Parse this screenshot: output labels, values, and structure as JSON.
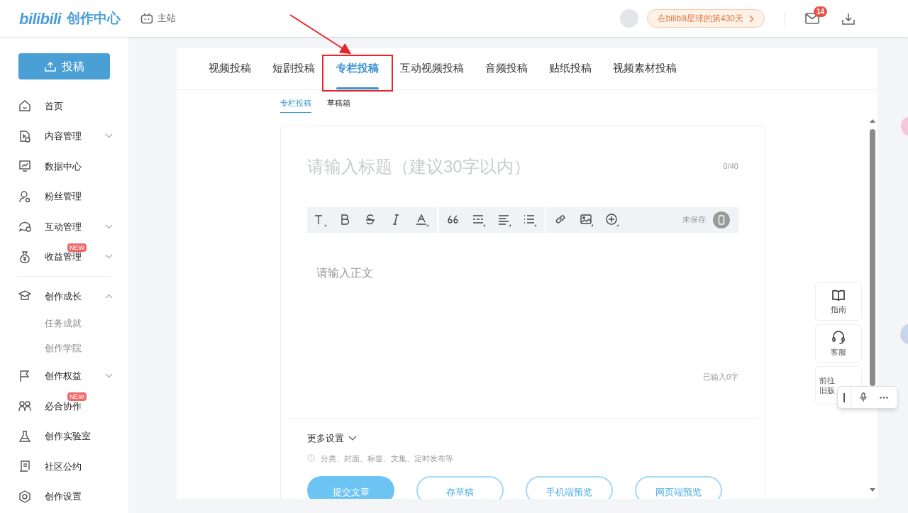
{
  "header": {
    "logo": "bilibili",
    "logo_suffix": "创作中心",
    "main_site": "主站",
    "days_pill": "在bilibili星球的第430天",
    "mail_count": "14"
  },
  "sidebar": {
    "upload_button": "投稿",
    "groups": [
      [
        {
          "label": "首页"
        },
        {
          "label": "内容管理",
          "expanded": false
        },
        {
          "label": "数据中心"
        },
        {
          "label": "粉丝管理"
        },
        {
          "label": "互动管理",
          "expanded": false
        },
        {
          "label": "收益管理",
          "expanded": false,
          "badge": "NEW"
        }
      ],
      [
        {
          "label": "创作成长",
          "expanded": true,
          "children": [
            {
              "label": "任务成就"
            },
            {
              "label": "创作学院"
            }
          ]
        },
        {
          "label": "创作权益",
          "expanded": false
        },
        {
          "label": "必合协作",
          "badge": "NEW"
        },
        {
          "label": "创作实验室"
        },
        {
          "label": "社区公约"
        },
        {
          "label": "创作设置"
        }
      ]
    ]
  },
  "tabs": [
    {
      "label": "视频投稿",
      "selected": false,
      "annotated": false
    },
    {
      "label": "短剧投稿",
      "selected": false,
      "annotated": false
    },
    {
      "label": "专栏投稿",
      "selected": true,
      "annotated": true
    },
    {
      "label": "互动视频投稿",
      "selected": false,
      "annotated": false
    },
    {
      "label": "音频投稿",
      "selected": false,
      "annotated": false
    },
    {
      "label": "贴纸投稿",
      "selected": false,
      "annotated": false
    },
    {
      "label": "视频素材投稿",
      "selected": false,
      "annotated": false
    }
  ],
  "subtabs": [
    {
      "label": "专栏投稿",
      "selected": true
    },
    {
      "label": "草稿箱",
      "selected": false
    }
  ],
  "editor": {
    "title_placeholder": "请输入标题（建议30字以内）",
    "title_count": "0/40",
    "save_status": "未保存",
    "body_placeholder": "请输入正文",
    "word_count": "已输入0字",
    "more_settings": "更多设置",
    "hint": "分类、封面、标签、文集、定时发布等",
    "buttons": [
      {
        "label": "提交文章",
        "kind": "primary"
      },
      {
        "label": "存草稿",
        "kind": "outline"
      },
      {
        "label": "手机端预览",
        "kind": "outline"
      },
      {
        "label": "网页端预览",
        "kind": "outline"
      }
    ]
  },
  "side_buttons": [
    {
      "label": "指南"
    },
    {
      "label": "客服"
    },
    {
      "label": "前往旧版"
    }
  ]
}
